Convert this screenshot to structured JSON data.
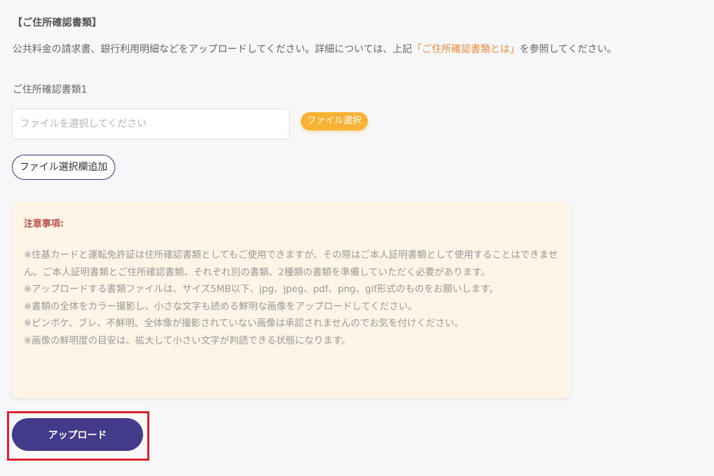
{
  "section": {
    "title": "【ご住所確認書類】"
  },
  "description": {
    "prefix": "公共料金の請求書、銀行利用明細などをアップロードしてください。詳細については、上記",
    "link_text": "「ご住所確認書類とは」",
    "suffix": "を参照してください。"
  },
  "upload_field": {
    "label": "ご住所確認書類1",
    "placeholder": "ファイルを選択してください",
    "value": "",
    "select_button_label": "ファイル選択"
  },
  "add_field_button_label": "ファイル選択欄追加",
  "notice": {
    "title": "注意事項:",
    "lines": [
      "※住基カードと運転免許証は住所確認書類としてもご使用できますが、その際はご本人証明書類として使用することはできません。ご本人証明書類とご住所確認書類、それぞれ別の書類、2種類の書類を準備していただく必要があります。",
      "※アップロードする書類ファイルは、サイズ5MB以下、jpg、jpeg、pdf、png、gif形式のものをお願いします。",
      "※書類の全体をカラー撮影し、小さな文字も読める鮮明な画像をアップロードしてください。",
      "※ピンボケ、ブレ、不鮮明、全体像が撮影されていない画像は承認されませんのでお気を付けください。",
      "※画像の鮮明度の目安は、拡大して小さい文字が判読できる状態になります。"
    ]
  },
  "upload_button_label": "アップロード",
  "colors": {
    "link": "#f08a3c",
    "select_button": "#f9b233",
    "notice_background": "#fef5e6",
    "notice_title": "#c0504d",
    "upload_button": "#433a8c",
    "highlight_border": "#d9232e"
  }
}
